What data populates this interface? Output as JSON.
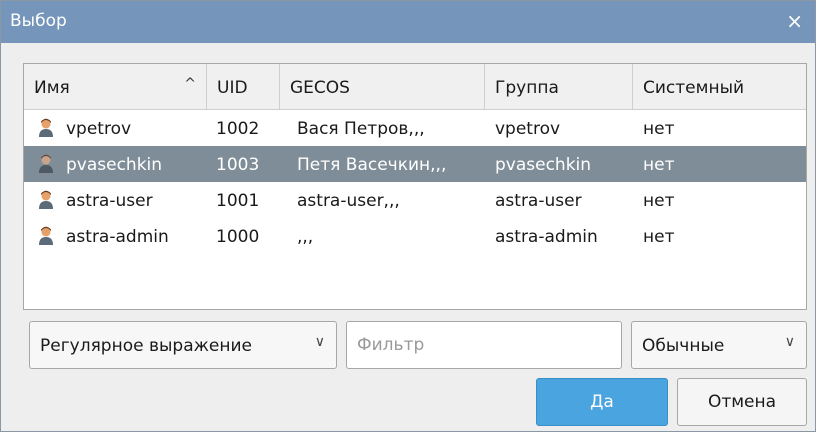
{
  "window": {
    "title": "Выбор",
    "close_icon": "×"
  },
  "table": {
    "columns": [
      "Имя",
      "UID",
      "GECOS",
      "Группа",
      "Системный"
    ],
    "sort_icon": "^",
    "rows": [
      {
        "name": "vpetrov",
        "uid": "1002",
        "gecos": "Вася Петров,,,",
        "group": "vpetrov",
        "system": "нет"
      },
      {
        "name": "pvasechkin",
        "uid": "1003",
        "gecos": "Петя Васечкин,,,",
        "group": "pvasechkin",
        "system": "нет"
      },
      {
        "name": "astra-user",
        "uid": "1001",
        "gecos": "astra-user,,,",
        "group": "astra-user",
        "system": "нет"
      },
      {
        "name": "astra-admin",
        "uid": "1000",
        "gecos": ",,,",
        "group": "astra-admin",
        "system": "нет"
      }
    ],
    "selected_index": 1
  },
  "filter": {
    "mode": "Регулярное выражение",
    "placeholder": "Фильтр",
    "value": "",
    "type": "Обычные"
  },
  "buttons": {
    "ok": "Да",
    "cancel": "Отмена"
  },
  "colors": {
    "titlebar": "#7596ba",
    "selection": "#7f8d98",
    "ok_button": "#4aa4e0"
  }
}
